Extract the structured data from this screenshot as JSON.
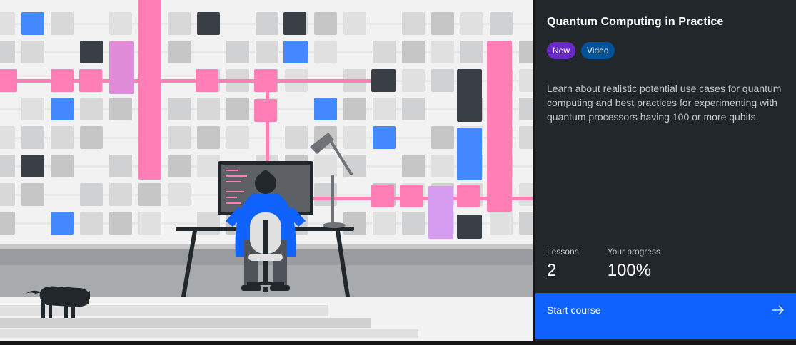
{
  "course": {
    "title": "Quantum Computing in Practice",
    "tags": [
      "New",
      "Video"
    ],
    "description": "Learn about realistic potential use cases for quantum computing and best practices for experimenting with quantum processors having 100 or more qubits.",
    "stats": {
      "lessons_label": "Lessons",
      "lessons_value": "2",
      "progress_label": "Your progress",
      "progress_value": "100%"
    },
    "action": {
      "label": "Start course",
      "icon": "arrow-right-icon"
    }
  },
  "colors": {
    "panel_bg": "#21272a",
    "accent_blue": "#0f62fe",
    "tag_new": "#6929c4",
    "tag_video": "#00539a",
    "circuit_pink": "#ff7eb6",
    "qubit_blue": "#4589ff",
    "qubit_dark": "#393f45"
  }
}
